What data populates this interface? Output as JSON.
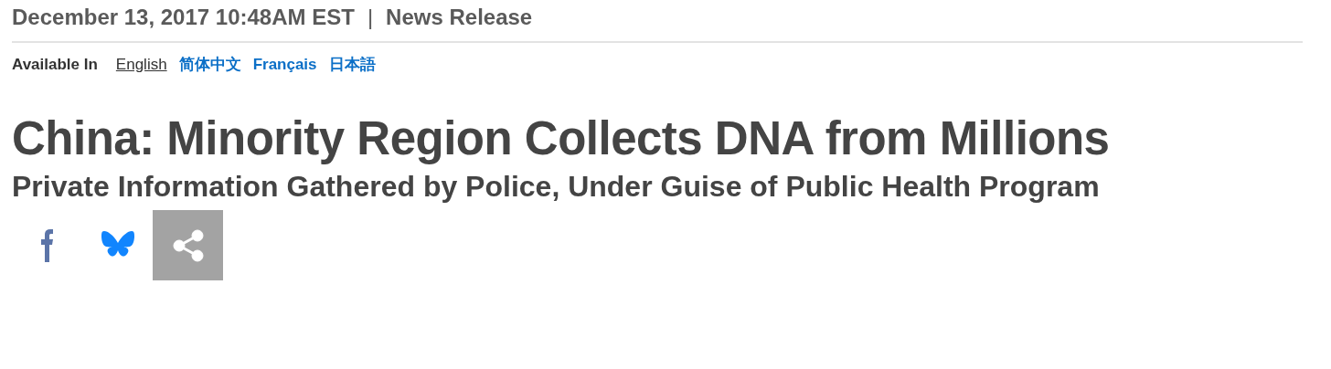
{
  "dateline": "December 13, 2017 10:48AM EST",
  "separator": "|",
  "category": "News Release",
  "languages_label": "Available In",
  "languages": [
    {
      "label": "English",
      "selected": true
    },
    {
      "label": "简体中文",
      "selected": false
    },
    {
      "label": "Français",
      "selected": false
    },
    {
      "label": "日本語",
      "selected": false
    }
  ],
  "title": "China: Minority Region Collects DNA from Millions",
  "subtitle": "Private Information Gathered by Police, Under Guise of Public Health Program",
  "share_buttons": [
    {
      "kind": "facebook"
    },
    {
      "kind": "bluesky"
    },
    {
      "kind": "share"
    }
  ]
}
